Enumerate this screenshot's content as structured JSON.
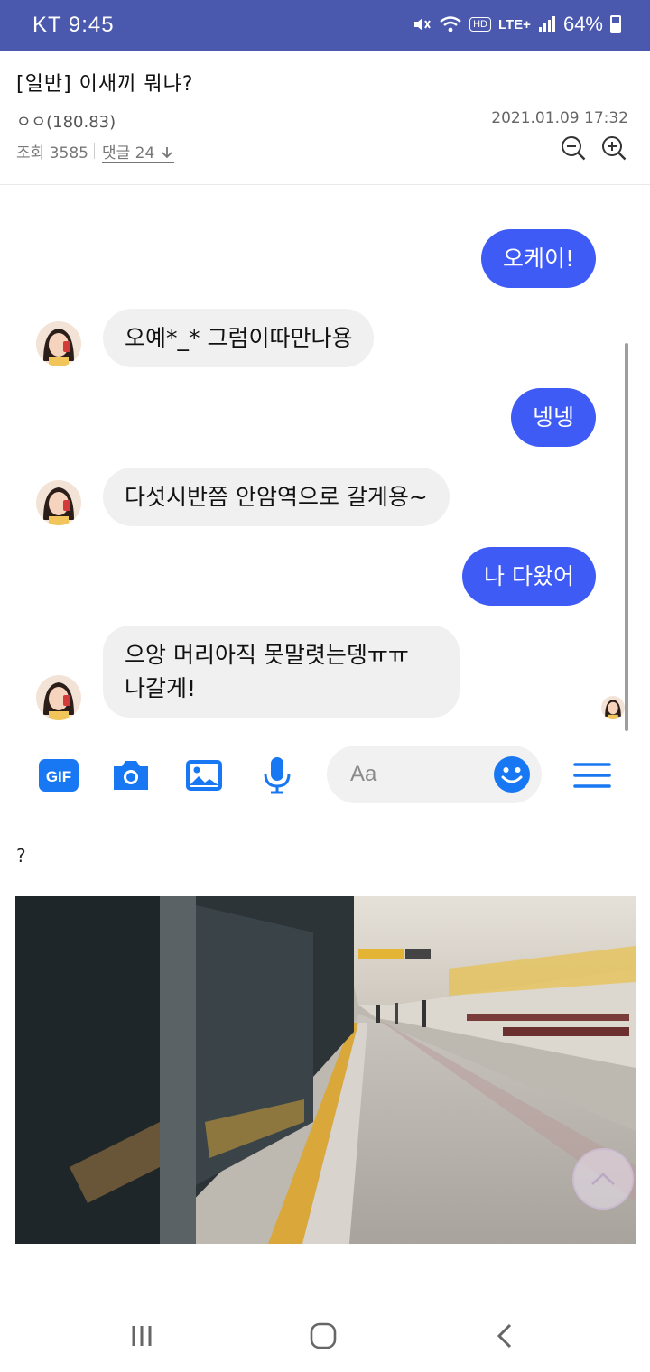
{
  "status_bar": {
    "carrier_time": "KT 9:45",
    "hd": "HD",
    "lte": "LTE+",
    "battery": "64%"
  },
  "post": {
    "title": "[일반] 이새끼 뭐냐?",
    "author": "ㅇㅇ(180.83)",
    "date": "2021.01.09 17:32",
    "views": "조회 3585",
    "comments": "댓글 24"
  },
  "chat": {
    "messages": [
      {
        "side": "out",
        "text": "오케이!"
      },
      {
        "side": "in",
        "text": "오예*_* 그럼이따만나용"
      },
      {
        "side": "out",
        "text": "넹넹"
      },
      {
        "side": "in",
        "text": "다섯시반쯤 안암역으로 갈게용~"
      },
      {
        "side": "out",
        "text": "나 다왔어"
      },
      {
        "side": "in",
        "line1": "으앙 머리아직 못말렷는뎅ㅠㅠ",
        "line2": "나갈게!"
      }
    ]
  },
  "composer": {
    "gif_label": "GIF",
    "placeholder": "Aa"
  },
  "body_text": "?",
  "colors": {
    "status_bar": "#4a58ad",
    "outgoing_bubble": "#3e5bf5",
    "incoming_bubble": "#f0f0f0",
    "toolbar_icon": "#1877f2"
  }
}
